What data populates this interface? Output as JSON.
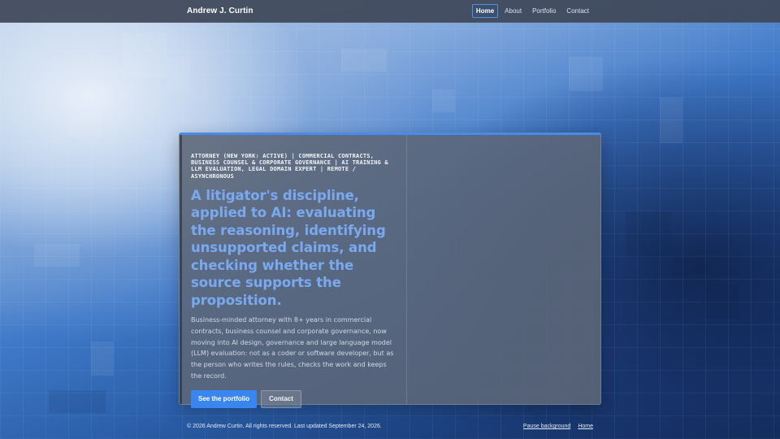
{
  "header": {
    "brand": "Andrew J. Curtin",
    "nav": [
      {
        "label": "Home",
        "active": true
      },
      {
        "label": "About",
        "active": false
      },
      {
        "label": "Portfolio",
        "active": false
      },
      {
        "label": "Contact",
        "active": false
      }
    ]
  },
  "hero": {
    "eyebrow": "ATTORNEY (NEW YORK: ACTIVE) | COMMERCIAL CONTRACTS, BUSINESS COUNSEL & CORPORATE GOVERNANCE | AI TRAINING & LLM EVALUATION, LEGAL DOMAIN EXPERT | REMOTE / ASYNCHRONOUS",
    "headline": "A litigator's discipline, applied to AI: evaluating the reasoning, identifying unsupported claims, and checking whether the source supports the proposition.",
    "lede": "Business-minded attorney with 8+ years in commercial contracts, business counsel and corporate governance, now moving into AI design, governance and large language model (LLM) evaluation: not as a coder or software developer, but as the person who writes the rules, checks the work and keeps the record.",
    "primary_button": "See the portfolio",
    "secondary_button": "Contact"
  },
  "footer": {
    "copyright": "© 2026 Andrew Curtin. All rights reserved. Last updated September 24, 2026.",
    "links": [
      "Pause background",
      "Home"
    ]
  },
  "colors": {
    "accent": "#4a8ae8",
    "headline": "#7aa9f0",
    "button_primary": "#3a86f0"
  }
}
